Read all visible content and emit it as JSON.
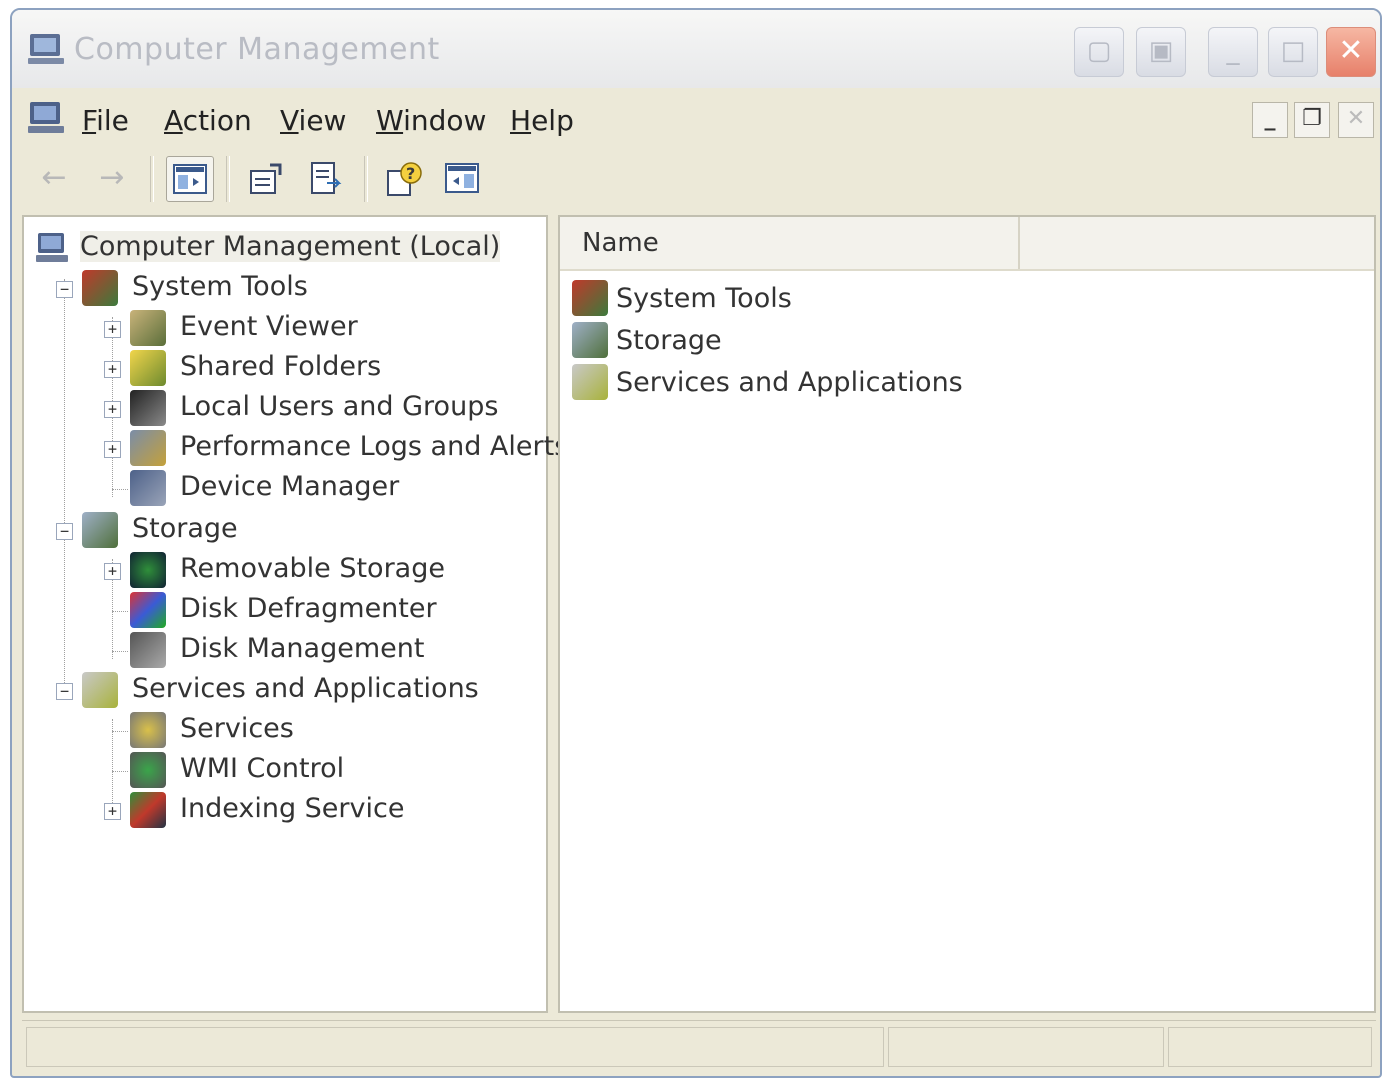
{
  "window": {
    "title": "Computer Management"
  },
  "menu": {
    "items": [
      {
        "label": "File",
        "accesskey": "F",
        "rest": "ile"
      },
      {
        "label": "Action",
        "accesskey": "A",
        "rest": "ction"
      },
      {
        "label": "View",
        "accesskey": "V",
        "rest": "iew"
      },
      {
        "label": "Window",
        "accesskey": "W",
        "rest": "indow"
      },
      {
        "label": "Help",
        "accesskey": "H",
        "rest": "elp"
      }
    ],
    "mdi": {
      "minimize": "_",
      "restore": "❐",
      "close": "✕"
    }
  },
  "toolbar": {
    "back": "←",
    "forward": "→"
  },
  "tree": {
    "root": "Computer Management (Local)",
    "items": [
      {
        "label": "System Tools",
        "icon": "system-tools-icon"
      },
      {
        "label": "Event Viewer",
        "icon": "event-viewer-icon"
      },
      {
        "label": "Shared Folders",
        "icon": "shared-folders-icon"
      },
      {
        "label": "Local Users and Groups",
        "icon": "local-users-icon"
      },
      {
        "label": "Performance Logs and Alerts",
        "icon": "performance-logs-icon"
      },
      {
        "label": "Device Manager",
        "icon": "device-manager-icon"
      },
      {
        "label": "Storage",
        "icon": "storage-icon"
      },
      {
        "label": "Removable Storage",
        "icon": "removable-storage-icon"
      },
      {
        "label": "Disk Defragmenter",
        "icon": "disk-defragmenter-icon"
      },
      {
        "label": "Disk Management",
        "icon": "disk-management-icon"
      },
      {
        "label": "Services and Applications",
        "icon": "services-applications-icon"
      },
      {
        "label": "Services",
        "icon": "services-icon"
      },
      {
        "label": "WMI Control",
        "icon": "wmi-control-icon"
      },
      {
        "label": "Indexing Service",
        "icon": "indexing-service-icon"
      }
    ],
    "expand_symbol": "+",
    "collapse_symbol": "−"
  },
  "list": {
    "column_name": "Name",
    "items": [
      {
        "label": "System Tools",
        "icon": "system-tools-icon"
      },
      {
        "label": "Storage",
        "icon": "storage-icon"
      },
      {
        "label": "Services and Applications",
        "icon": "services-applications-icon"
      }
    ]
  },
  "colors": {
    "close_button": "#e7806a",
    "window_frame": "#ece9d8",
    "border": "#8da2c0"
  }
}
